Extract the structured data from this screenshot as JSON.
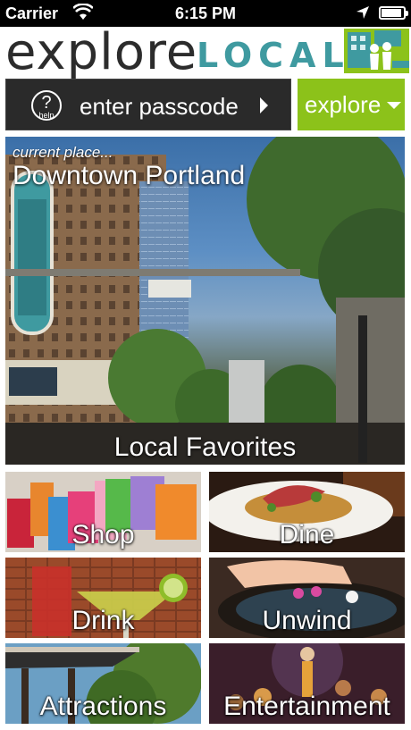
{
  "status_bar": {
    "carrier": "Carrier",
    "time": "6:15 PM"
  },
  "brand": {
    "word1": "explore",
    "word2": "LOCAL",
    "accent_color": "#3f9aa0"
  },
  "toolbar": {
    "help_symbol": "?",
    "help_label": "help",
    "passcode_label": "enter passcode",
    "explore_label": "explore",
    "explore_color": "#8cc21a"
  },
  "hero": {
    "current_label": "current place...",
    "place_name": "Downtown Portland",
    "favorites_label": "Local Favorites"
  },
  "categories": [
    {
      "label": "Shop"
    },
    {
      "label": "Dine"
    },
    {
      "label": "Drink"
    },
    {
      "label": "Unwind"
    },
    {
      "label": "Attractions"
    },
    {
      "label": "Entertainment"
    }
  ]
}
